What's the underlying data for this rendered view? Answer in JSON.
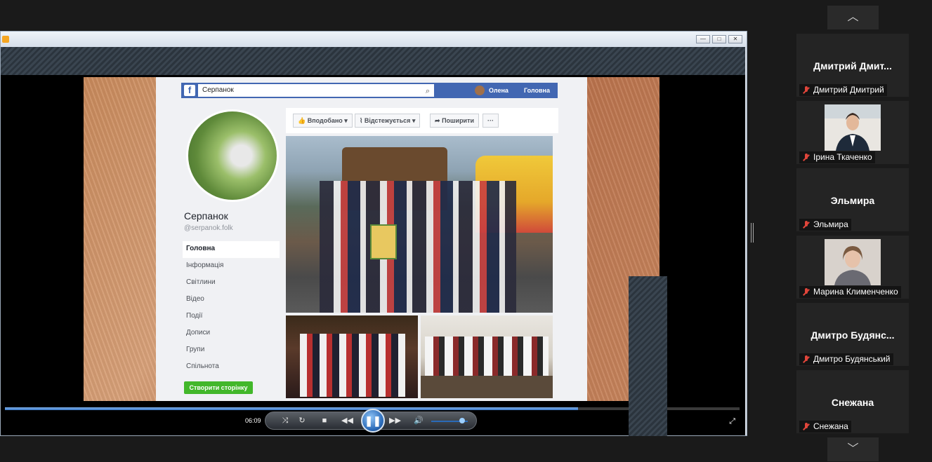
{
  "facebook": {
    "search_value": "Серпанок",
    "user_name": "Олена",
    "home_label": "Головна",
    "page_name": "Серпанок",
    "page_handle": "@serpanok.folk",
    "nav": [
      "Головна",
      "Інформація",
      "Світлини",
      "Відео",
      "Події",
      "Дописи",
      "Групи",
      "Спільнота"
    ],
    "create_page_label": "Створити сторінку",
    "actions": {
      "like": "Вподобано",
      "follow": "Відстежується",
      "share": "Поширити",
      "more": "···"
    }
  },
  "player": {
    "elapsed": "06:09",
    "progress": 0.78,
    "volume": 0.85
  },
  "participants": [
    {
      "display": "Дмитрий  Дмит...",
      "label": "Дмитрий Дмитрий",
      "has_video": false
    },
    {
      "display": "",
      "label": "Ірина Ткаченко",
      "has_video": true
    },
    {
      "display": "Эльмира",
      "label": "Эльмира",
      "has_video": false
    },
    {
      "display": "",
      "label": "Марина Клименченко",
      "has_video": true
    },
    {
      "display": "Дмитро  Будянс...",
      "label": "Дмитро Будянський",
      "has_video": false
    },
    {
      "display": "Снежана",
      "label": "Снежана",
      "has_video": false
    }
  ],
  "colors": {
    "fb_blue": "#4267b2",
    "fb_green": "#42b72a",
    "mic_muted": "#e0453a",
    "seek_fill": "#3a78c8"
  },
  "icons": {
    "scroll_up": "chevron-up-icon",
    "scroll_down": "chevron-down-icon",
    "muted": "mic-muted-icon"
  }
}
